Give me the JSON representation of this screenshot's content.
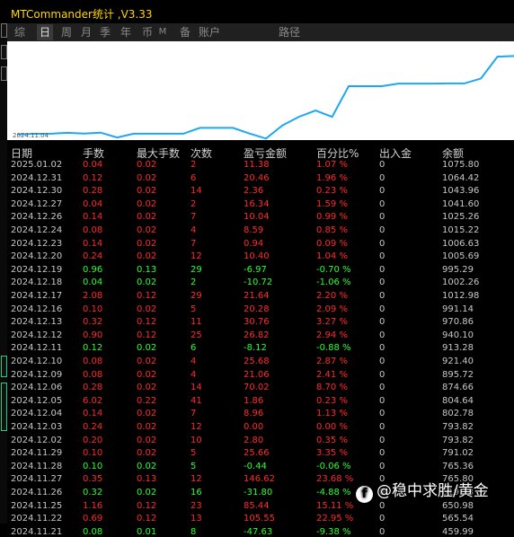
{
  "window": {
    "title": "MTCommander统计 ,V3.33"
  },
  "tabs": [
    {
      "label": "综",
      "active": false
    },
    {
      "label": "日",
      "active": true
    },
    {
      "label": "周",
      "active": false
    },
    {
      "label": "月",
      "active": false
    },
    {
      "label": "季",
      "active": false
    },
    {
      "label": "年",
      "active": false
    },
    {
      "label": "币",
      "active": false
    },
    {
      "label": "M",
      "active": false
    },
    {
      "label": "备",
      "active": false
    },
    {
      "label": "账户",
      "active": false
    },
    {
      "label": "路径",
      "active": false
    }
  ],
  "chart_data": {
    "type": "line",
    "color": "#1ea7f0",
    "start_date_label": "2024.11.04",
    "series": [
      {
        "values": [
          465,
          469,
          470,
          477,
          471,
          478,
          440,
          470,
          470,
          470,
          470,
          515,
          515,
          515,
          471,
          432,
          535,
          602,
          650,
          601,
          840,
          840,
          840,
          860,
          860,
          860,
          862,
          862,
          900,
          1070,
          1075
        ]
      }
    ],
    "ylim": [
      420,
      1190
    ]
  },
  "table": {
    "headers": [
      "日期",
      "手数",
      "最大手数",
      "次数",
      "盈亏金额",
      "百分比%",
      "出入金",
      "余额"
    ],
    "rows": [
      [
        "2025.01.02",
        "0.04",
        "0.02",
        "2",
        "11.38",
        "1.07 %",
        "0",
        "1075.80",
        "loss"
      ],
      [
        "2024.12.31",
        "0.12",
        "0.02",
        "6",
        "20.46",
        "1.96 %",
        "0",
        "1064.42",
        "loss"
      ],
      [
        "2024.12.30",
        "0.28",
        "0.02",
        "14",
        "2.36",
        "0.23 %",
        "0",
        "1043.96",
        "loss"
      ],
      [
        "2024.12.27",
        "0.04",
        "0.02",
        "2",
        "16.34",
        "1.59 %",
        "0",
        "1041.60",
        "loss"
      ],
      [
        "2024.12.26",
        "0.14",
        "0.02",
        "7",
        "10.04",
        "0.99 %",
        "0",
        "1025.26",
        "loss"
      ],
      [
        "2024.12.24",
        "0.08",
        "0.02",
        "4",
        "8.59",
        "0.85 %",
        "0",
        "1015.22",
        "loss"
      ],
      [
        "2024.12.23",
        "0.14",
        "0.02",
        "7",
        "0.94",
        "0.09 %",
        "0",
        "1006.63",
        "loss"
      ],
      [
        "2024.12.20",
        "0.24",
        "0.02",
        "12",
        "10.40",
        "1.04 %",
        "0",
        "1005.69",
        "loss"
      ],
      [
        "2024.12.19",
        "0.96",
        "0.13",
        "29",
        "-6.97",
        "-0.70 %",
        "0",
        "995.29",
        "win"
      ],
      [
        "2024.12.18",
        "0.04",
        "0.02",
        "2",
        "-10.72",
        "-1.06 %",
        "0",
        "1002.26",
        "win"
      ],
      [
        "2024.12.17",
        "2.08",
        "0.12",
        "29",
        "21.64",
        "2.20 %",
        "0",
        "1012.98",
        "loss"
      ],
      [
        "2024.12.16",
        "0.10",
        "0.02",
        "5",
        "20.28",
        "2.09 %",
        "0",
        "991.14",
        "loss"
      ],
      [
        "2024.12.13",
        "0.32",
        "0.12",
        "11",
        "30.76",
        "3.27 %",
        "0",
        "970.86",
        "loss"
      ],
      [
        "2024.12.12",
        "0.90",
        "0.12",
        "25",
        "26.82",
        "2.94 %",
        "0",
        "940.10",
        "loss"
      ],
      [
        "2024.12.11",
        "0.12",
        "0.02",
        "6",
        "-8.12",
        "-0.88 %",
        "0",
        "913.28",
        "win"
      ],
      [
        "2024.12.10",
        "0.08",
        "0.02",
        "4",
        "25.68",
        "2.87 %",
        "0",
        "921.40",
        "loss"
      ],
      [
        "2024.12.09",
        "0.08",
        "0.02",
        "4",
        "21.06",
        "2.41 %",
        "0",
        "895.72",
        "loss"
      ],
      [
        "2024.12.06",
        "0.28",
        "0.02",
        "14",
        "70.02",
        "8.70 %",
        "0",
        "874.66",
        "loss"
      ],
      [
        "2024.12.05",
        "6.02",
        "0.22",
        "41",
        "1.86",
        "0.23 %",
        "0",
        "804.64",
        "loss"
      ],
      [
        "2024.12.04",
        "0.14",
        "0.02",
        "7",
        "8.96",
        "1.13 %",
        "0",
        "802.78",
        "loss"
      ],
      [
        "2024.12.03",
        "0.24",
        "0.02",
        "12",
        "0.00",
        "0.00 %",
        "0",
        "793.82",
        "loss"
      ],
      [
        "2024.12.02",
        "0.20",
        "0.02",
        "10",
        "2.80",
        "0.35 %",
        "0",
        "793.82",
        "loss"
      ],
      [
        "2024.11.29",
        "0.10",
        "0.02",
        "5",
        "25.66",
        "3.35 %",
        "0",
        "791.02",
        "loss"
      ],
      [
        "2024.11.28",
        "0.10",
        "0.02",
        "5",
        "-0.44",
        "-0.06 %",
        "0",
        "765.36",
        "win"
      ],
      [
        "2024.11.27",
        "0.35",
        "0.13",
        "12",
        "146.62",
        "23.68 %",
        "0",
        "765.80",
        "loss"
      ],
      [
        "2024.11.26",
        "0.32",
        "0.02",
        "16",
        "-31.80",
        "-4.88 %",
        "0",
        "619.18",
        "win"
      ],
      [
        "2024.11.25",
        "1.16",
        "0.12",
        "23",
        "85.44",
        "15.11 %",
        "0",
        "650.98",
        "loss"
      ],
      [
        "2024.11.22",
        "0.69",
        "0.12",
        "13",
        "105.55",
        "22.95 %",
        "0",
        "565.54",
        "loss"
      ],
      [
        "2024.11.21",
        "0.08",
        "0.01",
        "8",
        "-47.63",
        "-9.38 %",
        "0",
        "459.99",
        "win"
      ]
    ]
  },
  "watermark": {
    "logo_glyph": "f",
    "text": "@稳中求胜/黄金"
  }
}
